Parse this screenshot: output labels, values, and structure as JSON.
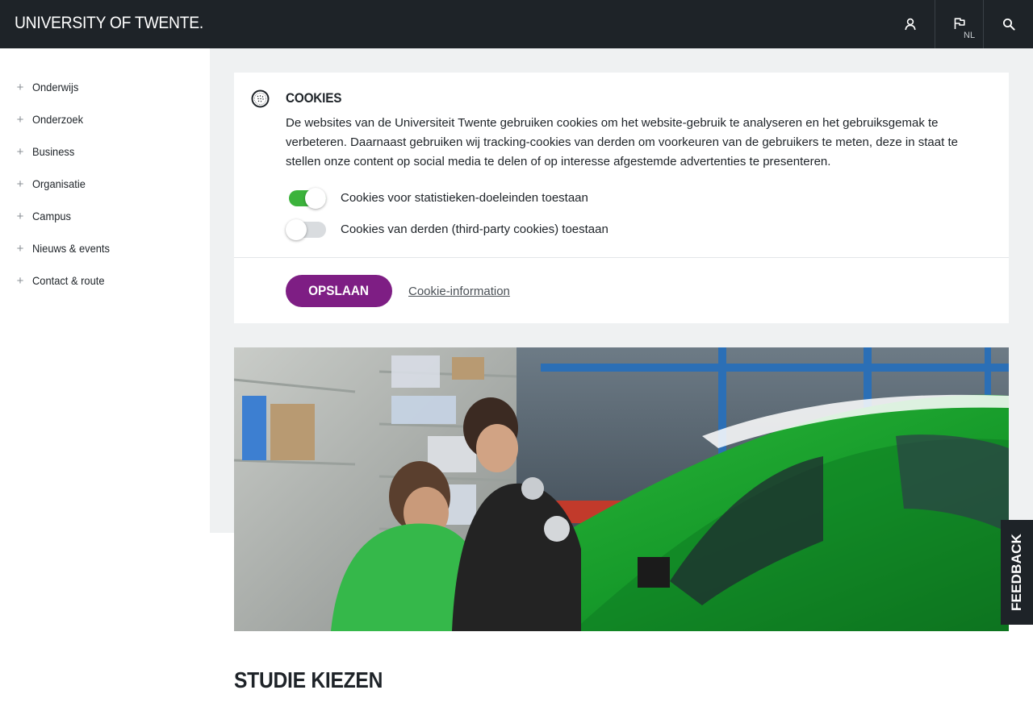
{
  "header": {
    "logo": "UNIVERSITY OF TWENTE.",
    "language_code": "NL"
  },
  "sidebar": {
    "items": [
      {
        "label": "Onderwijs"
      },
      {
        "label": "Onderzoek"
      },
      {
        "label": "Business"
      },
      {
        "label": "Organisatie"
      },
      {
        "label": "Campus"
      },
      {
        "label": "Nieuws & events"
      },
      {
        "label": "Contact & route"
      }
    ]
  },
  "cookie_panel": {
    "title": "COOKIES",
    "description": "De websites van de Universiteit Twente gebruiken cookies om het website-gebruik te analyseren en het gebruiksgemak te verbeteren. Daarnaast gebruiken wij tracking-cookies van derden om voorkeuren van de gebruikers te meten, deze in staat te stellen onze content op social media te delen of op interesse afgestemde advertenties te presenteren.",
    "toggles": [
      {
        "label": "Cookies voor statistieken-doeleinden toestaan",
        "checked": true
      },
      {
        "label": "Cookies van derden (third-party cookies) toestaan",
        "checked": false
      }
    ],
    "save_label": "OPSLAAN",
    "info_link": "Cookie-information"
  },
  "main": {
    "section_title": "STUDIE KIEZEN"
  },
  "feedback_label": "FEEDBACK",
  "colors": {
    "header_bg": "#1e2328",
    "accent_purple": "#7e1e84",
    "toggle_on": "#3cb33c",
    "content_bg": "#eff1f2"
  }
}
